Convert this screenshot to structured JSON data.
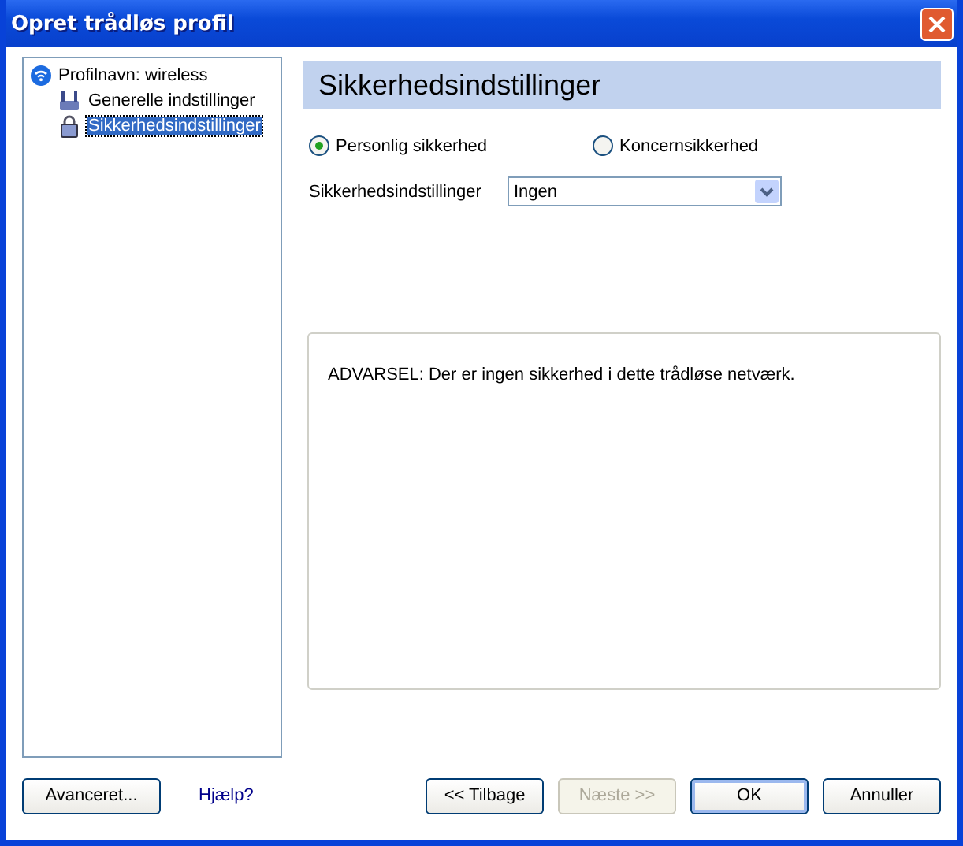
{
  "window": {
    "title": "Opret trådløs profil"
  },
  "tree": [
    {
      "label": "Profilnavn: wireless",
      "kind": "wifi",
      "selected": false,
      "children": [
        {
          "label": "Generelle indstillinger",
          "kind": "network",
          "selected": false
        },
        {
          "label": "Sikkerhedsindstillinger",
          "kind": "lock",
          "selected": true
        }
      ]
    }
  ],
  "panel": {
    "heading": "Sikkerhedsindstillinger",
    "radios": [
      {
        "label": "Personlig sikkerhed",
        "selected": true
      },
      {
        "label": "Koncernsikkerhed",
        "selected": false
      }
    ],
    "security_label": "Sikkerhedsindstillinger",
    "security_value": "Ingen",
    "warning": "ADVARSEL: Der er ingen sikkerhed i dette trådløse netværk."
  },
  "footer": {
    "advanced": "Avanceret...",
    "help": "Hjælp?",
    "buttons": [
      {
        "label": "<< Tilbage",
        "disabled": false,
        "default": false
      },
      {
        "label": "Næste >>",
        "disabled": true,
        "default": false
      },
      {
        "label": "OK",
        "disabled": false,
        "default": true
      },
      {
        "label": "Annuller",
        "disabled": false,
        "default": false
      }
    ]
  }
}
